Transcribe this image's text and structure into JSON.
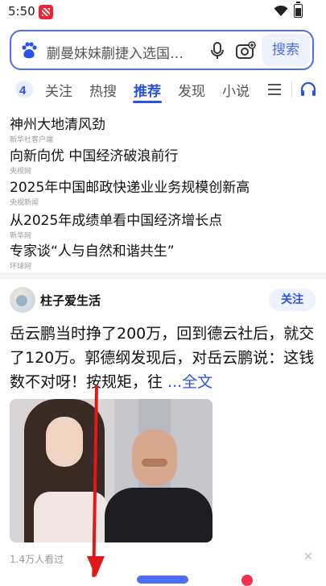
{
  "status": {
    "time": "5:50"
  },
  "search": {
    "placeholder": "蒯曼妹妹蒯捷入选国…",
    "button": "搜索"
  },
  "tabs": [
    {
      "label": "关注"
    },
    {
      "label": "热搜"
    },
    {
      "label": "推荐",
      "active": true
    },
    {
      "label": "发现"
    },
    {
      "label": "小说"
    }
  ],
  "news": [
    {
      "title": "神州大地清风劲",
      "source": "新华社客户端"
    },
    {
      "title": "向新向优 中国经济破浪前行",
      "source": "央视网"
    },
    {
      "title": "2025年中国邮政快递业业务规模创新高",
      "source": "央视新闻"
    },
    {
      "title": "从2025年成绩单看中国经济增长点",
      "source": "新华网"
    },
    {
      "title": "专家谈“人与自然和谐共生”",
      "source": "环球网"
    }
  ],
  "feed": {
    "author": "柱子爱生活",
    "follow": "关注",
    "text": "岳云鹏当时挣了200万，回到德云社后，就交了120万。郭德纲发现后，对岳云鹏说：这钱数不对呀！按规矩，往 ",
    "more": "...全文",
    "views": "1.4万人看过"
  },
  "colors": {
    "accent": "#2b52e6",
    "search_border": "#4e6ef2",
    "annotation": "#e01818"
  }
}
